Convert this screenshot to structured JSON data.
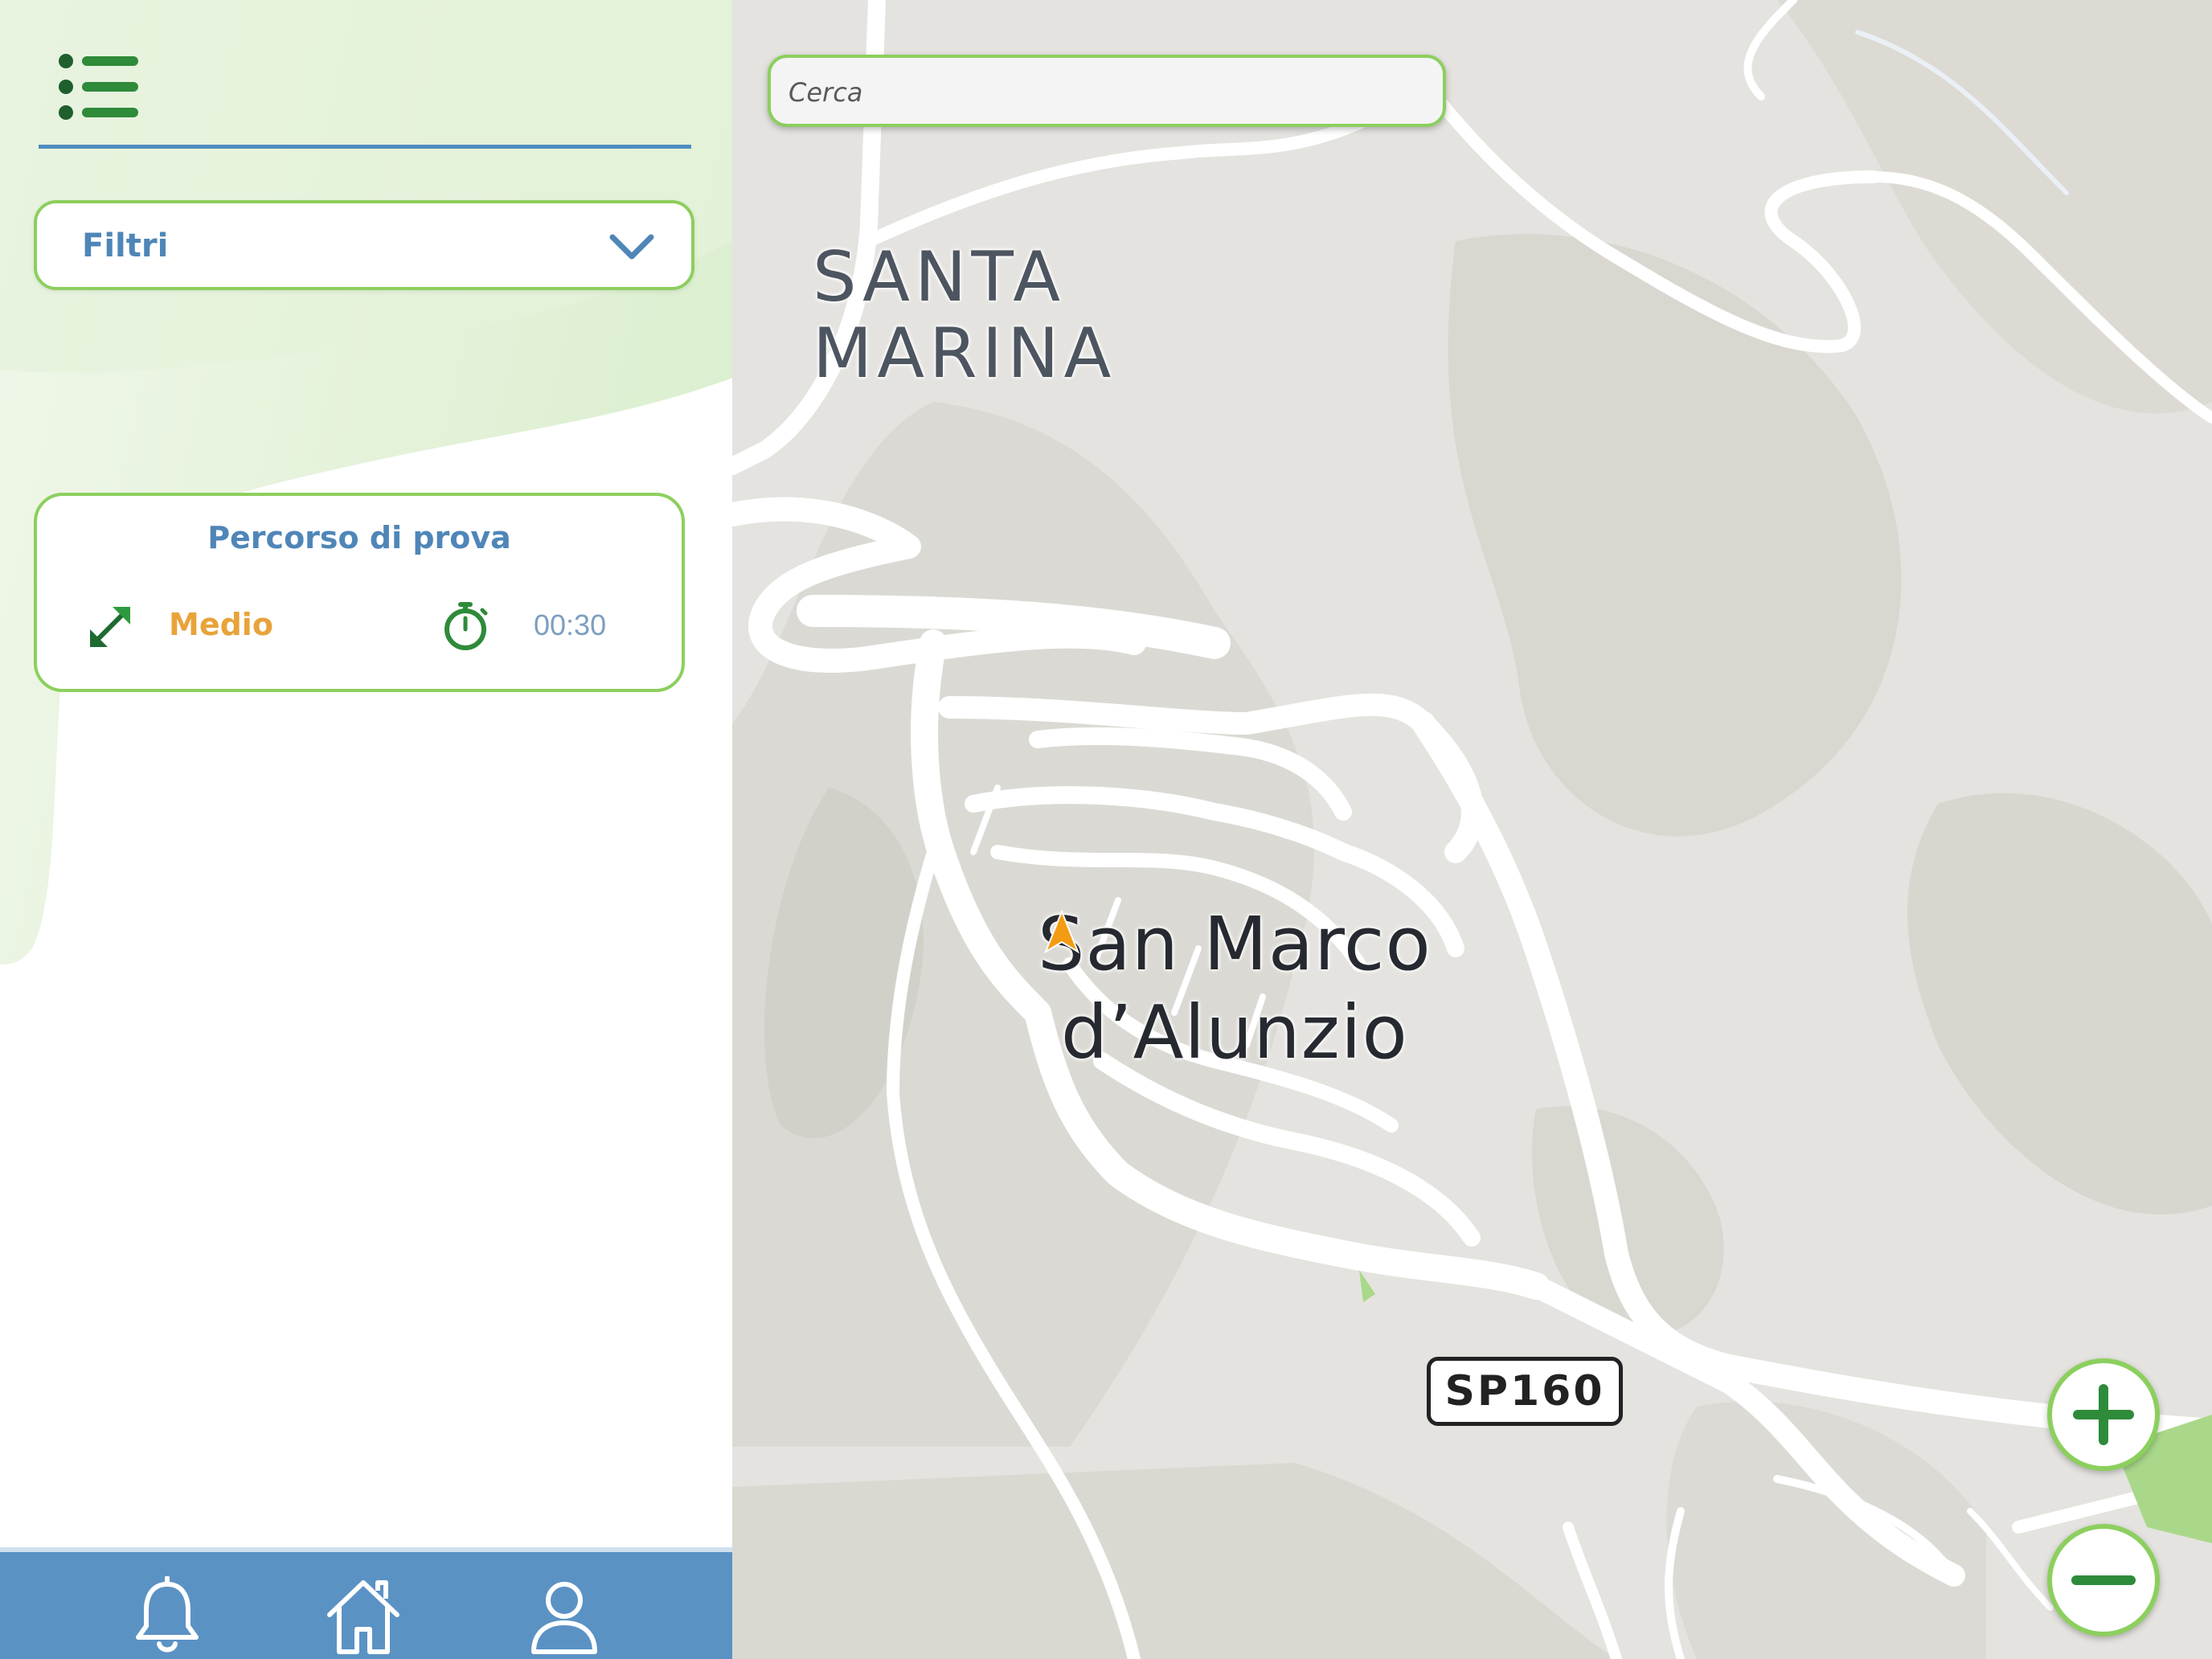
{
  "sidebar": {
    "menu_icon": "list-icon",
    "filter": {
      "label": "Filtri",
      "icon": "chevron-down-icon"
    },
    "routes": [
      {
        "title": "Percorso di prova",
        "difficulty": "Medio",
        "duration": "00:30",
        "difficulty_icon": "expand-arrows-icon",
        "duration_icon": "stopwatch-icon"
      }
    ]
  },
  "bottom_nav": {
    "items": [
      {
        "name": "notifications",
        "icon": "bell-icon"
      },
      {
        "name": "home",
        "icon": "home-icon"
      },
      {
        "name": "profile",
        "icon": "user-icon"
      }
    ]
  },
  "map": {
    "search": {
      "placeholder": "Cerca",
      "value": ""
    },
    "places": {
      "santa_marina": "SANTA MARINA",
      "san_marco_line1": "San Marco",
      "san_marco_line2": "d’Alunzio"
    },
    "road_badge": "SP160",
    "controls": {
      "zoom_in_icon": "plus-icon",
      "zoom_out_icon": "minus-icon"
    }
  },
  "colors": {
    "accent_green": "#8ccf5e",
    "dark_green": "#2e8b3a",
    "brand_blue": "#4f86b8",
    "nav_blue": "#5b92c4",
    "difficulty_orange": "#e8a33a",
    "marker_orange": "#f39c12"
  }
}
